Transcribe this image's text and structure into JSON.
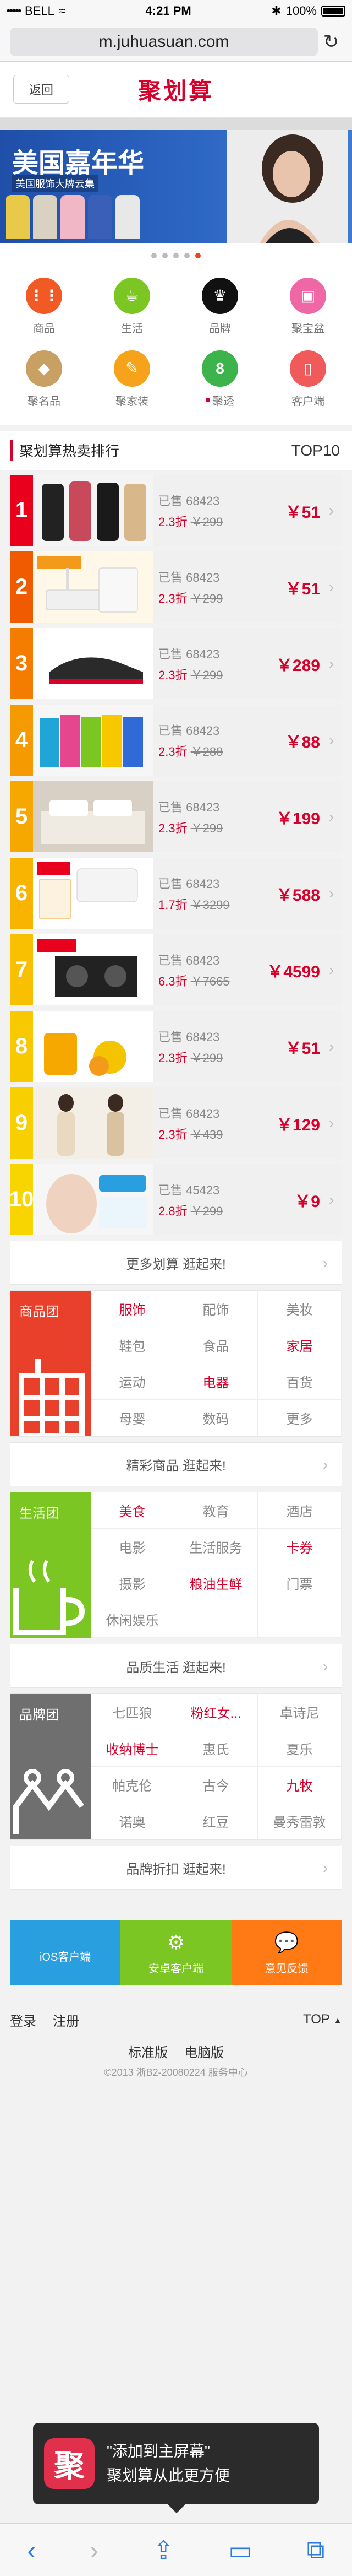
{
  "status": {
    "dots": "•••••",
    "carrier": "BELL",
    "wifi": "≈",
    "time": "4:21 PM",
    "bluetooth": "✱",
    "battery": "100%"
  },
  "browser": {
    "url": "m.juhuasuan.com",
    "reload_icon": "↻"
  },
  "header": {
    "back": "返回",
    "brand": "聚划算"
  },
  "banner": {
    "title": "美国嘉年华",
    "subtitle": "美国服饰大牌云集",
    "dots_count": 5,
    "active_dot": 4
  },
  "categories": [
    {
      "label": "商品",
      "icon": "apps-icon",
      "color": "#f15a24",
      "glyph": "⋮⋮"
    },
    {
      "label": "生活",
      "icon": "cup-icon",
      "color": "#7cc623",
      "glyph": "☕"
    },
    {
      "label": "品牌",
      "icon": "crown-icon",
      "color": "#111111",
      "glyph": "♛"
    },
    {
      "label": "聚宝盆",
      "icon": "bag-icon",
      "color": "#f067a6",
      "glyph": "▣"
    },
    {
      "label": "聚名品",
      "icon": "diamond-icon",
      "color": "#c9a063",
      "glyph": "◆"
    },
    {
      "label": "聚家装",
      "icon": "brush-icon",
      "color": "#f7a21b",
      "glyph": "✎"
    },
    {
      "label": "聚透",
      "icon": "number-8-icon",
      "color": "#3cb44b",
      "glyph": "8",
      "dot": true
    },
    {
      "label": "客户端",
      "icon": "phone-icon",
      "color": "#f05a5a",
      "glyph": "▯"
    }
  ],
  "ranking": {
    "title": "聚划算热卖排行",
    "tag": "TOP10",
    "items": [
      {
        "rank": "1",
        "sold": "已售 68423",
        "discount": "2.3折",
        "original": "￥299",
        "price": "￥51",
        "color": "#e8001c",
        "img": "dresses"
      },
      {
        "rank": "2",
        "sold": "已售 68423",
        "discount": "2.3折",
        "original": "￥299",
        "price": "￥51",
        "color": "#f05a00",
        "img": "router"
      },
      {
        "rank": "3",
        "sold": "已售 68423",
        "discount": "2.3折",
        "original": "￥299",
        "price": "￥289",
        "color": "#f47d00",
        "img": "shoe"
      },
      {
        "rank": "4",
        "sold": "已售 68423",
        "discount": "2.3折",
        "original": "￥288",
        "price": "￥88",
        "color": "#f59a00",
        "img": "jackets"
      },
      {
        "rank": "5",
        "sold": "已售 68423",
        "discount": "2.3折",
        "original": "￥299",
        "price": "￥199",
        "color": "#f7a800",
        "img": "bedding"
      },
      {
        "rank": "6",
        "sold": "已售 68423",
        "discount": "1.7折",
        "original": "￥3299",
        "price": "￥588",
        "color": "#f8b400",
        "img": "heater"
      },
      {
        "rank": "7",
        "sold": "已售 68423",
        "discount": "6.3折",
        "original": "￥7665",
        "price": "￥4599",
        "color": "#f8c000",
        "img": "stove"
      },
      {
        "rank": "8",
        "sold": "已售 68423",
        "discount": "2.3折",
        "original": "￥299",
        "price": "￥51",
        "color": "#f8c800",
        "img": "honey"
      },
      {
        "rank": "9",
        "sold": "已售 68423",
        "discount": "2.3折",
        "original": "￥439",
        "price": "￥129",
        "color": "#f8cf00",
        "img": "women"
      },
      {
        "rank": "10",
        "sold": "已售 45423",
        "discount": "2.8折",
        "original": "￥299",
        "price": "￥9",
        "color": "#f8d500",
        "img": "mask"
      }
    ],
    "more": "更多划算  逛起来!"
  },
  "groups": [
    {
      "name": "商品团",
      "color": "#e8402b",
      "icon": "building-icon",
      "items": [
        {
          "t": "服饰",
          "hot": true
        },
        {
          "t": "配饰",
          "hot": false
        },
        {
          "t": "美妆",
          "hot": false
        },
        {
          "t": "鞋包",
          "hot": false
        },
        {
          "t": "食品",
          "hot": false
        },
        {
          "t": "家居",
          "hot": true
        },
        {
          "t": "运动",
          "hot": false
        },
        {
          "t": "电器",
          "hot": true
        },
        {
          "t": "百货",
          "hot": false
        },
        {
          "t": "母婴",
          "hot": false
        },
        {
          "t": "数码",
          "hot": false
        },
        {
          "t": "更多",
          "hot": false
        }
      ],
      "more": "精彩商品  逛起来!"
    },
    {
      "name": "生活团",
      "color": "#7cc623",
      "icon": "cup-icon",
      "items": [
        {
          "t": "美食",
          "hot": true
        },
        {
          "t": "教育",
          "hot": false
        },
        {
          "t": "酒店",
          "hot": false
        },
        {
          "t": "电影",
          "hot": false
        },
        {
          "t": "生活服务",
          "hot": false
        },
        {
          "t": "卡券",
          "hot": true
        },
        {
          "t": "摄影",
          "hot": false
        },
        {
          "t": "粮油生鲜",
          "hot": true
        },
        {
          "t": "门票",
          "hot": false
        },
        {
          "t": "休闲娱乐",
          "hot": false
        }
      ],
      "more": "品质生活  逛起来!"
    },
    {
      "name": "品牌团",
      "color": "#6f6f6f",
      "icon": "crown-icon",
      "items": [
        {
          "t": "七匹狼",
          "hot": false
        },
        {
          "t": "粉红女...",
          "hot": true
        },
        {
          "t": "卓诗尼",
          "hot": false
        },
        {
          "t": "收纳博士",
          "hot": true
        },
        {
          "t": "惠氏",
          "hot": false
        },
        {
          "t": "夏乐",
          "hot": false
        },
        {
          "t": "帕克伦",
          "hot": false
        },
        {
          "t": "古今",
          "hot": false
        },
        {
          "t": "九牧",
          "hot": true
        },
        {
          "t": "诺奥",
          "hot": false
        },
        {
          "t": "红豆",
          "hot": false
        },
        {
          "t": "曼秀雷敦",
          "hot": false
        }
      ],
      "more": "品牌折扣  逛起来!"
    }
  ],
  "clients": [
    {
      "label": "iOS客户端",
      "color": "#2a9fe0",
      "icon": "apple-icon",
      "glyph": ""
    },
    {
      "label": "安卓客户端",
      "color": "#7cc623",
      "icon": "android-icon",
      "glyph": "⚙"
    },
    {
      "label": "意见反馈",
      "color": "#ff7a14",
      "icon": "chat-icon",
      "glyph": "💬"
    }
  ],
  "footer": {
    "login": "登录",
    "register": "注册",
    "top": "TOP",
    "std": "标准版",
    "pc": "电脑版",
    "copyright": "©2013 浙B2-20080224   服务中心"
  },
  "popup": {
    "logo": "聚",
    "line1": "\"添加到主屏幕\"",
    "line2": "聚划算从此更方便"
  },
  "toolbar": {
    "back": "‹",
    "forward": "›",
    "share": "⇪",
    "bookmarks": "▭",
    "tabs": "⧉"
  }
}
